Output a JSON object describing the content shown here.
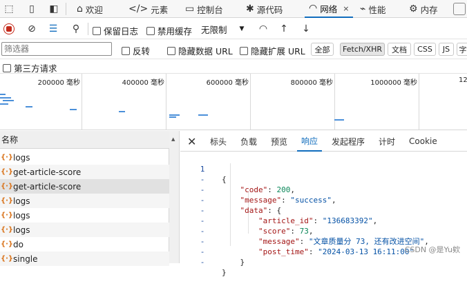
{
  "tabs": [
    {
      "label": "欢迎",
      "icon": "home-icon"
    },
    {
      "label": "元素",
      "icon": "code-tag-icon"
    },
    {
      "label": "控制台",
      "icon": "console-icon"
    },
    {
      "label": "源代码",
      "icon": "bug-icon"
    },
    {
      "label": "网络",
      "icon": "wifi-icon",
      "close": "×"
    },
    {
      "label": "性能",
      "icon": "performance-icon"
    },
    {
      "label": "内存",
      "icon": "gear-icon"
    }
  ],
  "toolbar": {
    "preserve_log": "保留日志",
    "disable_cache": "禁用缓存",
    "throttle_value": "无限制"
  },
  "filter": {
    "placeholder": "筛选器",
    "invert": "反转",
    "hide_data_url": "隐藏数据 URL",
    "hide_ext_url": "隐藏扩展 URL",
    "types": [
      "全部",
      "Fetch/XHR",
      "文档",
      "CSS",
      "JS",
      "字"
    ],
    "active_type": "Fetch/XHR",
    "third_party": "第三方请求"
  },
  "timeline": {
    "ticks": [
      "200000 毫秒",
      "400000 毫秒",
      "600000 毫秒",
      "800000 毫秒",
      "1000000 毫秒",
      "12"
    ]
  },
  "requests": {
    "header": "名称",
    "items": [
      {
        "name": "logs"
      },
      {
        "name": "get-article-score"
      },
      {
        "name": "get-article-score",
        "selected": true
      },
      {
        "name": "logs"
      },
      {
        "name": "logs"
      },
      {
        "name": "logs"
      },
      {
        "name": "do"
      },
      {
        "name": "single"
      }
    ]
  },
  "detail": {
    "tabs": [
      "标头",
      "负载",
      "预览",
      "响应",
      "发起程序",
      "计时",
      "Cookie"
    ],
    "active_tab": "响应",
    "gutter": [
      "1",
      "-",
      "-",
      "-",
      "-",
      "-",
      "-",
      "-",
      "-",
      "-"
    ],
    "response": {
      "code": "200",
      "message": "\"success\"",
      "article_id": "\"136683392\"",
      "score": "73",
      "data_message": "\"文章质量分 73, 还有改进空间\"",
      "post_time": "\"2024-03-13 16:11:00\""
    }
  },
  "watermark": "CSDN @是Yu欸"
}
